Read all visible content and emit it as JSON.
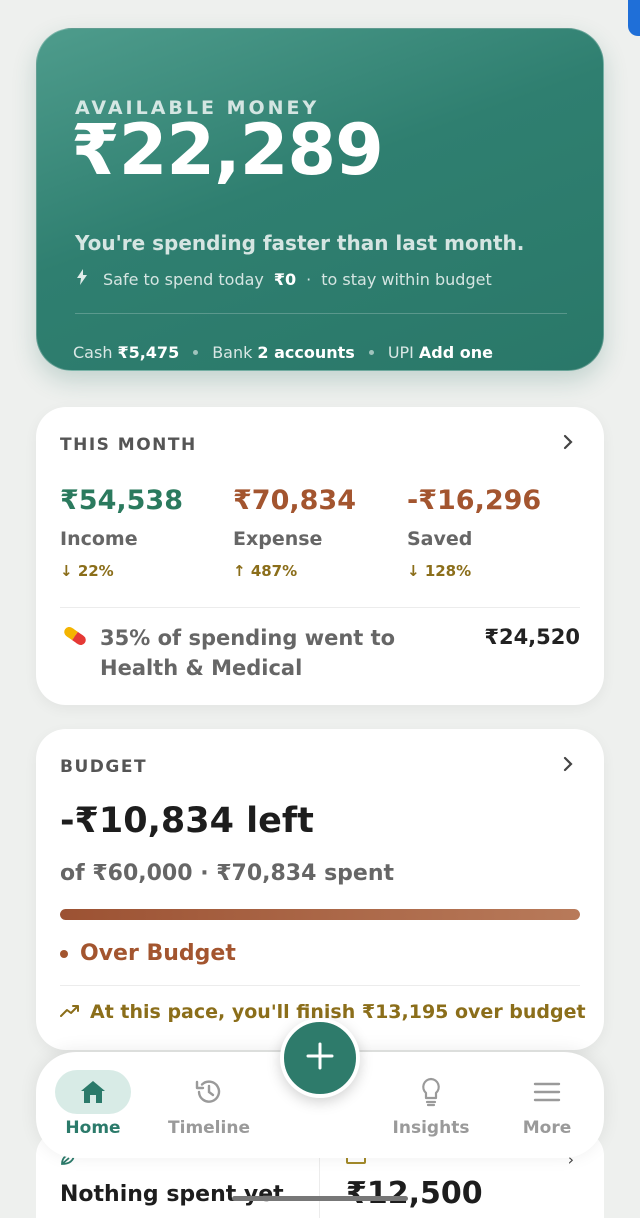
{
  "hero": {
    "label": "AVAILABLE MONEY",
    "amount": "₹22,289",
    "message": "You're spending faster than last month.",
    "safe_prefix": "Safe to spend today",
    "safe_amount": "₹0",
    "safe_suffix": "to stay within budget",
    "cash_label": "Cash",
    "cash_value": "₹5,475",
    "bank_label": "Bank",
    "bank_value": "2 accounts",
    "upi_label": "UPI",
    "upi_value": "Add one"
  },
  "month": {
    "title": "THIS MONTH",
    "income": {
      "value": "₹54,538",
      "label": "Income",
      "arrow": "↓",
      "change": "22%"
    },
    "expense": {
      "value": "₹70,834",
      "label": "Expense",
      "arrow": "↑",
      "change": "487%"
    },
    "saved": {
      "value": "-₹16,296",
      "label": "Saved",
      "arrow": "↓",
      "change": "128%"
    },
    "insight": "35% of spending went to Health & Medical",
    "insight_amount": "₹24,520"
  },
  "budget": {
    "title": "BUDGET",
    "left": "-₹10,834 left",
    "of_text": "of ₹60,000 · ₹70,834 spent",
    "progress_fraction": 1.0,
    "status": "Over Budget",
    "pace": "At this pace, you'll finish ₹13,195 over budget"
  },
  "bottom": {
    "left_text": "Nothing spent yet",
    "right_amount": "₹12,500"
  },
  "nav": {
    "home": "Home",
    "timeline": "Timeline",
    "insights": "Insights",
    "more": "More"
  },
  "colors": {
    "accent": "#2e7b6b",
    "income": "#2b7a5e",
    "expense": "#a3552f",
    "warning": "#8b6e1a"
  }
}
